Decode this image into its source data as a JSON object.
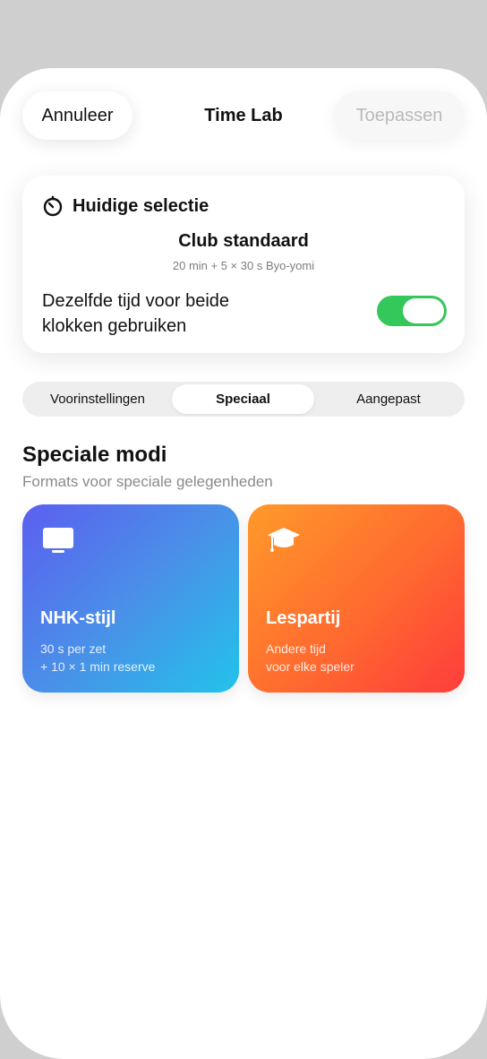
{
  "header": {
    "cancel_label": "Annuleer",
    "title": "Time Lab",
    "apply_label": "Toepassen"
  },
  "selection": {
    "heading": "Huidige selectie",
    "heading_icon": "timer-icon",
    "preset_name": "Club standaard",
    "preset_detail": "20 min + 5 × 30 s Byo-yomi",
    "toggle_label": "Dezelfde tijd voor beide klokken gebruiken",
    "toggle_on": true,
    "toggle_color": "#34c759"
  },
  "tabs": [
    {
      "label": "Voorinstellingen",
      "selected": false
    },
    {
      "label": "Speciaal",
      "selected": true
    },
    {
      "label": "Aangepast",
      "selected": false
    }
  ],
  "section": {
    "title": "Speciale modi",
    "subtitle": "Formats voor speciale gelegenheden"
  },
  "modes": [
    {
      "icon": "tv-icon",
      "title": "NHK-stijl",
      "line1": "30 s per zet",
      "line2": "+ 10 × 1 min reserve",
      "gradient": [
        "#5b5ff0",
        "#22c3ea"
      ]
    },
    {
      "icon": "graduation-cap-icon",
      "title": "Lespartij",
      "line1": "Andere tijd",
      "line2": "voor elke speler",
      "gradient": [
        "#ff9a2a",
        "#ff3c3c"
      ]
    }
  ]
}
